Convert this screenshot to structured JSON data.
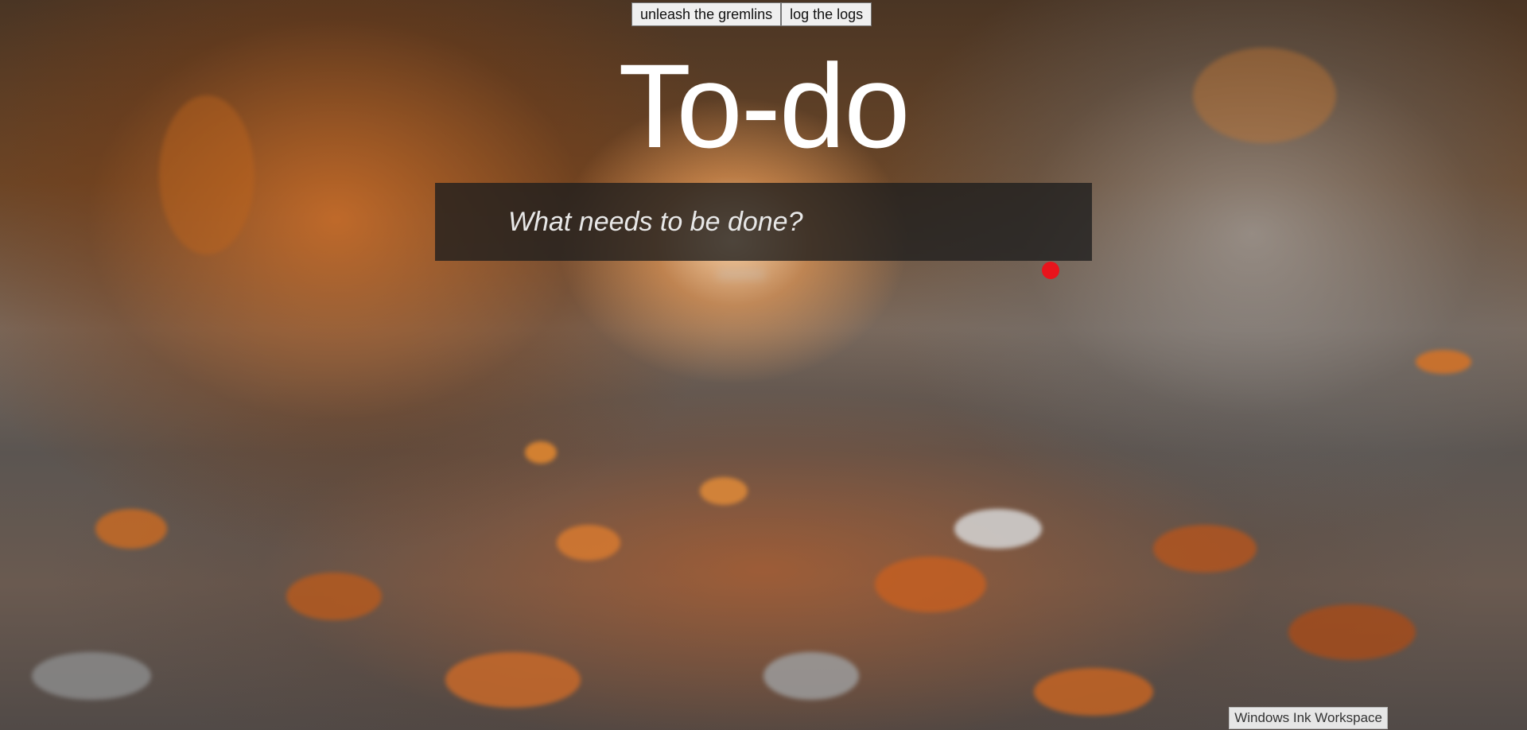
{
  "toolbar": {
    "gremlins_label": "unleash the gremlins",
    "logs_label": "log the logs"
  },
  "app": {
    "title": "To-do",
    "new_todo_placeholder": "What needs to be done?",
    "new_todo_value": ""
  },
  "taskbar": {
    "ink_workspace_label": "Windows Ink Workspace"
  },
  "colors": {
    "title_text": "#ffffff",
    "input_background": "#1e1e1e",
    "cursor_dot": "#e8141c"
  },
  "background": {
    "description_icon": "autumn-forest-path-photo"
  }
}
